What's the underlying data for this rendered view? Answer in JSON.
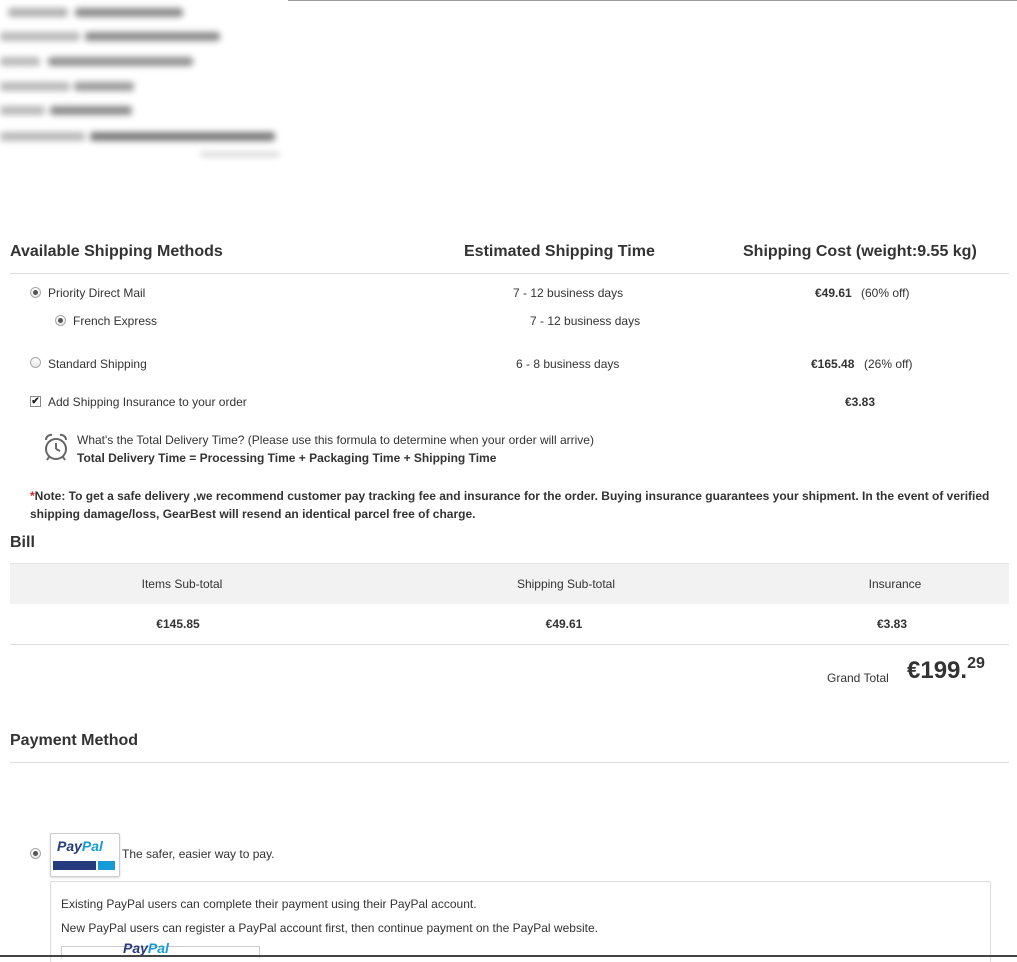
{
  "shipping": {
    "header": {
      "methods": "Available Shipping Methods",
      "time": "Estimated Shipping Time",
      "cost": "Shipping Cost (weight:9.55 kg)"
    },
    "options": [
      {
        "label": "Priority Direct Mail",
        "time": "7 - 12 business days",
        "price": "€49.61",
        "discount": "(60% off)",
        "selected": true
      },
      {
        "label": "French Express",
        "time": "7 - 12 business days",
        "selected": true
      },
      {
        "label": "Standard Shipping",
        "time": "6 - 8 business days",
        "price": "€165.48",
        "discount": "(26% off)",
        "selected": false
      }
    ],
    "insurance": {
      "label": "Add Shipping Insurance to your order",
      "price": "€3.83",
      "checked": true
    },
    "delivery_info": {
      "question": "What's the Total Delivery Time? (Please use this formula to determine when your order will arrive)",
      "formula": "Total Delivery Time = Processing Time + Packaging Time + Shipping Time"
    },
    "note_star": "*",
    "note": "Note: To get a safe delivery ,we recommend customer pay tracking fee and insurance for the order. Buying insurance guarantees your shipment. In the event of verified shipping damage/loss, GearBest will resend an identical parcel free of charge."
  },
  "bill": {
    "title": "Bill",
    "columns": [
      "Items Sub-total",
      "Shipping Sub-total",
      "Insurance"
    ],
    "values": [
      "€145.85",
      "€49.61",
      "€3.83"
    ],
    "grand_total_label": "Grand Total",
    "grand_total_main": "€199.",
    "grand_total_cents": "29"
  },
  "payment": {
    "title": "Payment Method",
    "paypal": {
      "logo_text_1": "Pay",
      "logo_text_2": "Pal",
      "tagline": "The safer, easier way to pay.",
      "line1": "Existing PayPal users can complete their payment using their PayPal account.",
      "line2": "New PayPal users can register a PayPal account first, then continue payment on the PayPal website."
    }
  },
  "colors": {
    "paypal_dark": "#253b80",
    "paypal_light": "#179bd7",
    "note_star": "#e02020"
  }
}
